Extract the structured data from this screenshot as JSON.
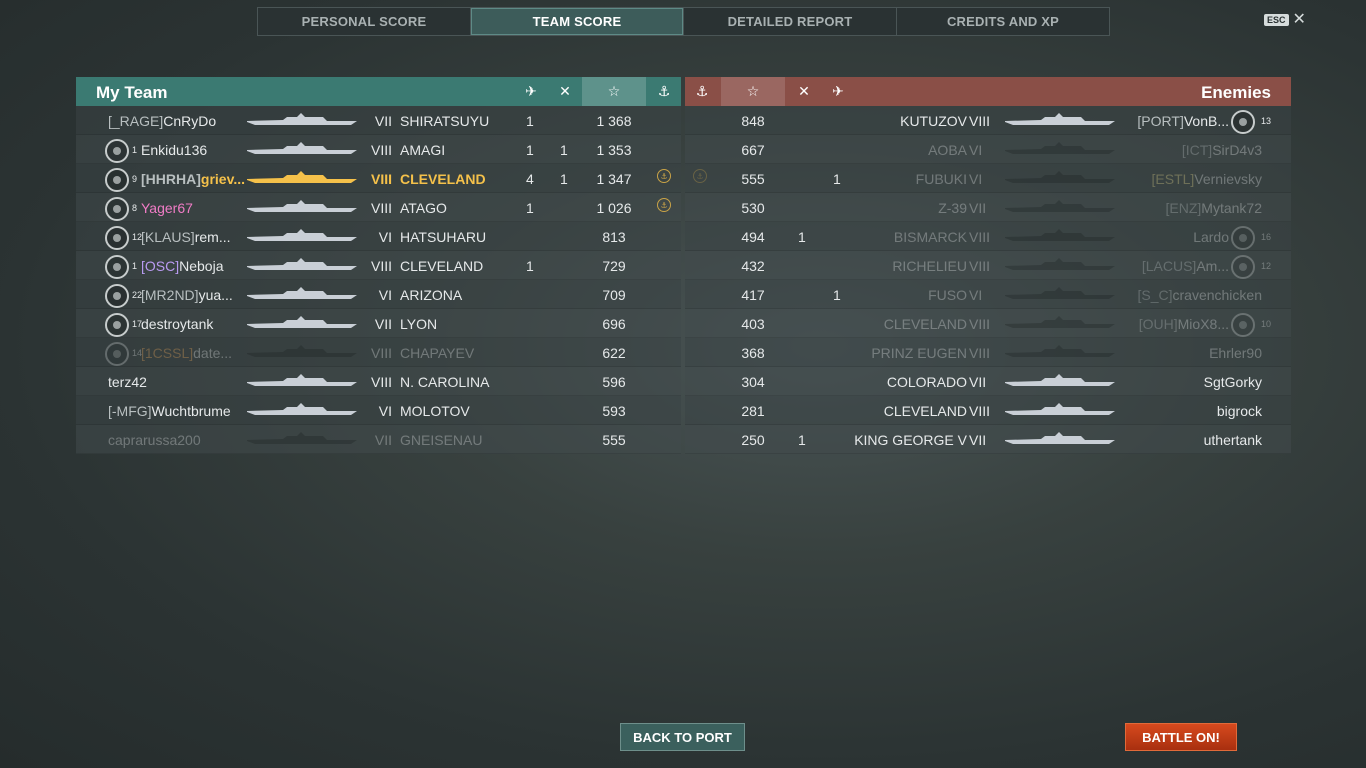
{
  "tabs": [
    {
      "label": "PERSONAL SCORE",
      "active": false
    },
    {
      "label": "TEAM SCORE",
      "active": true
    },
    {
      "label": "DETAILED REPORT",
      "active": false
    },
    {
      "label": "CREDITS AND XP",
      "active": false
    }
  ],
  "esc": {
    "key": "ESC",
    "close": "✕"
  },
  "my_team": {
    "title": "My Team",
    "rows": [
      {
        "clan": "[_RAGE]",
        "name": "CnRyDo",
        "tier": "VII",
        "ship": "SHIRATSUYU",
        "planes": "1",
        "kills": "",
        "score": "1 368",
        "rank": "",
        "ribbon": false,
        "style": ""
      },
      {
        "clan": "",
        "name": "Enkidu136",
        "rank": "1",
        "tier": "VIII",
        "ship": "AMAGI",
        "planes": "1",
        "kills": "1",
        "score": "1 353",
        "ribbon": false,
        "style": ""
      },
      {
        "clan": "[HHRHA]",
        "name": "griev...",
        "rank": "9",
        "tier": "VIII",
        "ship": "CLEVELAND",
        "planes": "4",
        "kills": "1",
        "score": "1 347",
        "ribbon": true,
        "style": "player"
      },
      {
        "clan": "",
        "name": "Yager67",
        "rank": "8",
        "tier": "VIII",
        "ship": "ATAGO",
        "planes": "1",
        "kills": "",
        "score": "1 026",
        "ribbon": true,
        "style": "pink"
      },
      {
        "clan": "[KLAUS]",
        "name": "rem...",
        "rank": "12",
        "tier": "VI",
        "ship": "HATSUHARU",
        "planes": "",
        "kills": "",
        "score": "813",
        "ribbon": false,
        "style": ""
      },
      {
        "clan": "[OSC]",
        "name": "Neboja",
        "rank": "1",
        "tier": "VIII",
        "ship": "CLEVELAND",
        "planes": "1",
        "kills": "",
        "score": "729",
        "ribbon": false,
        "style": "purpleclan"
      },
      {
        "clan": "[MR2ND]",
        "name": "yua...",
        "rank": "22",
        "tier": "VI",
        "ship": "ARIZONA",
        "planes": "",
        "kills": "",
        "score": "709",
        "ribbon": false,
        "style": ""
      },
      {
        "clan": "",
        "name": "destroytank",
        "rank": "17",
        "tier": "VII",
        "ship": "LYON",
        "planes": "",
        "kills": "",
        "score": "696",
        "ribbon": false,
        "style": ""
      },
      {
        "clan": "[1CSSL]",
        "name": "date...",
        "rank": "14",
        "tier": "VIII",
        "ship": "CHAPAYEV",
        "planes": "",
        "kills": "",
        "score": "622",
        "ribbon": false,
        "style": "dead orangeclan"
      },
      {
        "clan": "",
        "name": "terz42",
        "rank": "",
        "tier": "VIII",
        "ship": "N. CAROLINA",
        "planes": "",
        "kills": "",
        "score": "596",
        "ribbon": false,
        "style": ""
      },
      {
        "clan": "[-MFG]",
        "name": "Wuchtbrume",
        "rank": "",
        "tier": "VI",
        "ship": "MOLOTOV",
        "planes": "",
        "kills": "",
        "score": "593",
        "ribbon": false,
        "style": ""
      },
      {
        "clan": "",
        "name": "caprarussa200",
        "rank": "",
        "tier": "VII",
        "ship": "GNEISENAU",
        "planes": "",
        "kills": "",
        "score": "555",
        "ribbon": false,
        "style": "dead"
      }
    ]
  },
  "enemies": {
    "title": "Enemies",
    "rows": [
      {
        "score": "848",
        "kills": "",
        "planes": "",
        "ship": "KUTUZOV",
        "tier": "VIII",
        "clan": "[PORT]",
        "name": "VonB...",
        "rank": "13",
        "ribbon": false,
        "style": ""
      },
      {
        "score": "667",
        "kills": "",
        "planes": "",
        "ship": "AOBA",
        "tier": "VI",
        "clan": "[ICT]",
        "name": "SirD4v3",
        "rank": "",
        "ribbon": false,
        "style": "dead"
      },
      {
        "score": "555",
        "kills": "",
        "planes": "1",
        "ship": "FUBUKI",
        "tier": "VI",
        "clan": "[ESTL]",
        "name": "Vernievsky",
        "rank": "",
        "ribbon": true,
        "style": "dead yellowclan"
      },
      {
        "score": "530",
        "kills": "",
        "planes": "",
        "ship": "Z-39",
        "tier": "VII",
        "clan": "[ENZ]",
        "name": "Mytank72",
        "rank": "",
        "ribbon": false,
        "style": "dead"
      },
      {
        "score": "494",
        "kills": "1",
        "planes": "",
        "ship": "BISMARCK",
        "tier": "VIII",
        "clan": "",
        "name": "Lardo",
        "rank": "16",
        "ribbon": false,
        "style": "dead"
      },
      {
        "score": "432",
        "kills": "",
        "planes": "",
        "ship": "RICHELIEU",
        "tier": "VIII",
        "clan": "[LACUS]",
        "name": "Am...",
        "rank": "12",
        "ribbon": false,
        "style": "dead"
      },
      {
        "score": "417",
        "kills": "",
        "planes": "1",
        "ship": "FUSO",
        "tier": "VI",
        "clan": "[S_C]",
        "name": "cravenchicken",
        "rank": "",
        "ribbon": false,
        "style": "dead"
      },
      {
        "score": "403",
        "kills": "",
        "planes": "",
        "ship": "CLEVELAND",
        "tier": "VIII",
        "clan": "[OUH]",
        "name": "MioX8...",
        "rank": "10",
        "ribbon": false,
        "style": "dead"
      },
      {
        "score": "368",
        "kills": "",
        "planes": "",
        "ship": "PRINZ EUGEN",
        "tier": "VIII",
        "clan": "",
        "name": "Ehrler90",
        "rank": "",
        "ribbon": false,
        "style": "dead"
      },
      {
        "score": "304",
        "kills": "",
        "planes": "",
        "ship": "COLORADO",
        "tier": "VII",
        "clan": "",
        "name": "SgtGorky",
        "rank": "",
        "ribbon": false,
        "style": ""
      },
      {
        "score": "281",
        "kills": "",
        "planes": "",
        "ship": "CLEVELAND",
        "tier": "VIII",
        "clan": "",
        "name": "bigrock",
        "rank": "",
        "ribbon": false,
        "style": ""
      },
      {
        "score": "250",
        "kills": "1",
        "planes": "",
        "ship": "KING GEORGE V",
        "tier": "VII",
        "clan": "",
        "name": "uthertank",
        "rank": "",
        "ribbon": false,
        "style": ""
      }
    ]
  },
  "header_icons": {
    "planes": "✈",
    "kills": "✕",
    "score": "☆",
    "ribbons": "⚓"
  },
  "buttons": {
    "back": "BACK TO PORT",
    "battle": "BATTLE ON!"
  },
  "colors": {
    "my_header": "#3b7a72",
    "enemy_header": "#8a4f47",
    "player_highlight": "#f5c14a",
    "battle_button": "#c23c14"
  }
}
